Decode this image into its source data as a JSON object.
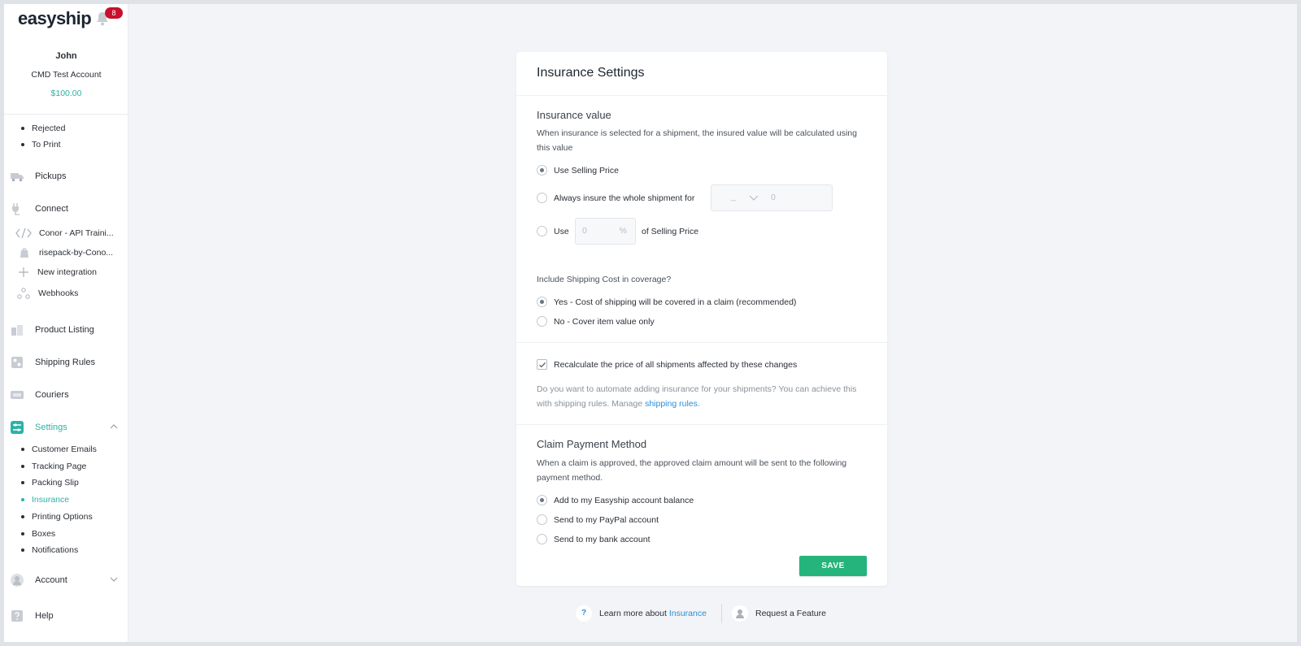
{
  "brand": {
    "name": "easyship",
    "notification_count": "8"
  },
  "user": {
    "name": "John",
    "account": "CMD Test Account",
    "balance": "$100.00"
  },
  "sidebar": {
    "shipment_subitems": [
      "Rejected",
      "To Print"
    ],
    "pickups": "Pickups",
    "connect": "Connect",
    "integrations": [
      {
        "label": "Conor - API Traini...",
        "icon": "code-icon"
      },
      {
        "label": "risepack-by-Cono...",
        "icon": "shopping-bag-icon"
      },
      {
        "label": "New integration",
        "icon": "plus-icon"
      },
      {
        "label": "Webhooks",
        "icon": "webhooks-icon"
      }
    ],
    "product_listing": "Product Listing",
    "shipping_rules": "Shipping Rules",
    "couriers": "Couriers",
    "settings": "Settings",
    "settings_subitems": [
      "Customer Emails",
      "Tracking Page",
      "Packing Slip",
      "Insurance",
      "Printing Options",
      "Boxes",
      "Notifications"
    ],
    "active_subitem": "Insurance",
    "account": "Account",
    "help": "Help"
  },
  "card": {
    "title": "Insurance Settings",
    "insurance_value": {
      "title": "Insurance value",
      "description": "When insurance is selected for a shipment, the insured value will be calculated using this value",
      "options": {
        "selling_price": "Use Selling Price",
        "whole_shipment": "Always insure the whole shipment for",
        "use": "Use",
        "of_selling_price": "of Selling Price"
      },
      "currency_placeholder": "_",
      "amount_placeholder": "0",
      "percent_placeholder": "0",
      "percent_unit": "%",
      "selected": "selling_price"
    },
    "shipping_cost": {
      "question": "Include Shipping Cost in coverage?",
      "yes": "Yes - Cost of shipping will be covered in a claim (recommended)",
      "no": "No - Cover item value only",
      "selected": "yes"
    },
    "recalculate": {
      "label": "Recalculate the price of all shipments affected by these changes",
      "checked": true
    },
    "automate_note": {
      "text": "Do you want to automate adding insurance for your shipments? You can achieve this with shipping rules. Manage ",
      "link": "shipping rules",
      "suffix": "."
    },
    "claim_payment": {
      "title": "Claim Payment Method",
      "description": "When a claim is approved, the approved claim amount will be sent to the following payment method.",
      "options": {
        "balance": "Add to my Easyship account balance",
        "paypal": "Send to my PayPal account",
        "bank": "Send to my bank account"
      },
      "selected": "balance"
    },
    "save_label": "SAVE"
  },
  "footer": {
    "help_glyph": "?",
    "learn_prefix": "Learn more about ",
    "learn_link": "Insurance",
    "request": "Request a Feature"
  },
  "colors": {
    "accent": "#2ab3a6",
    "save": "#25b47b",
    "link": "#2b8fd6",
    "badge": "#c8102e"
  }
}
